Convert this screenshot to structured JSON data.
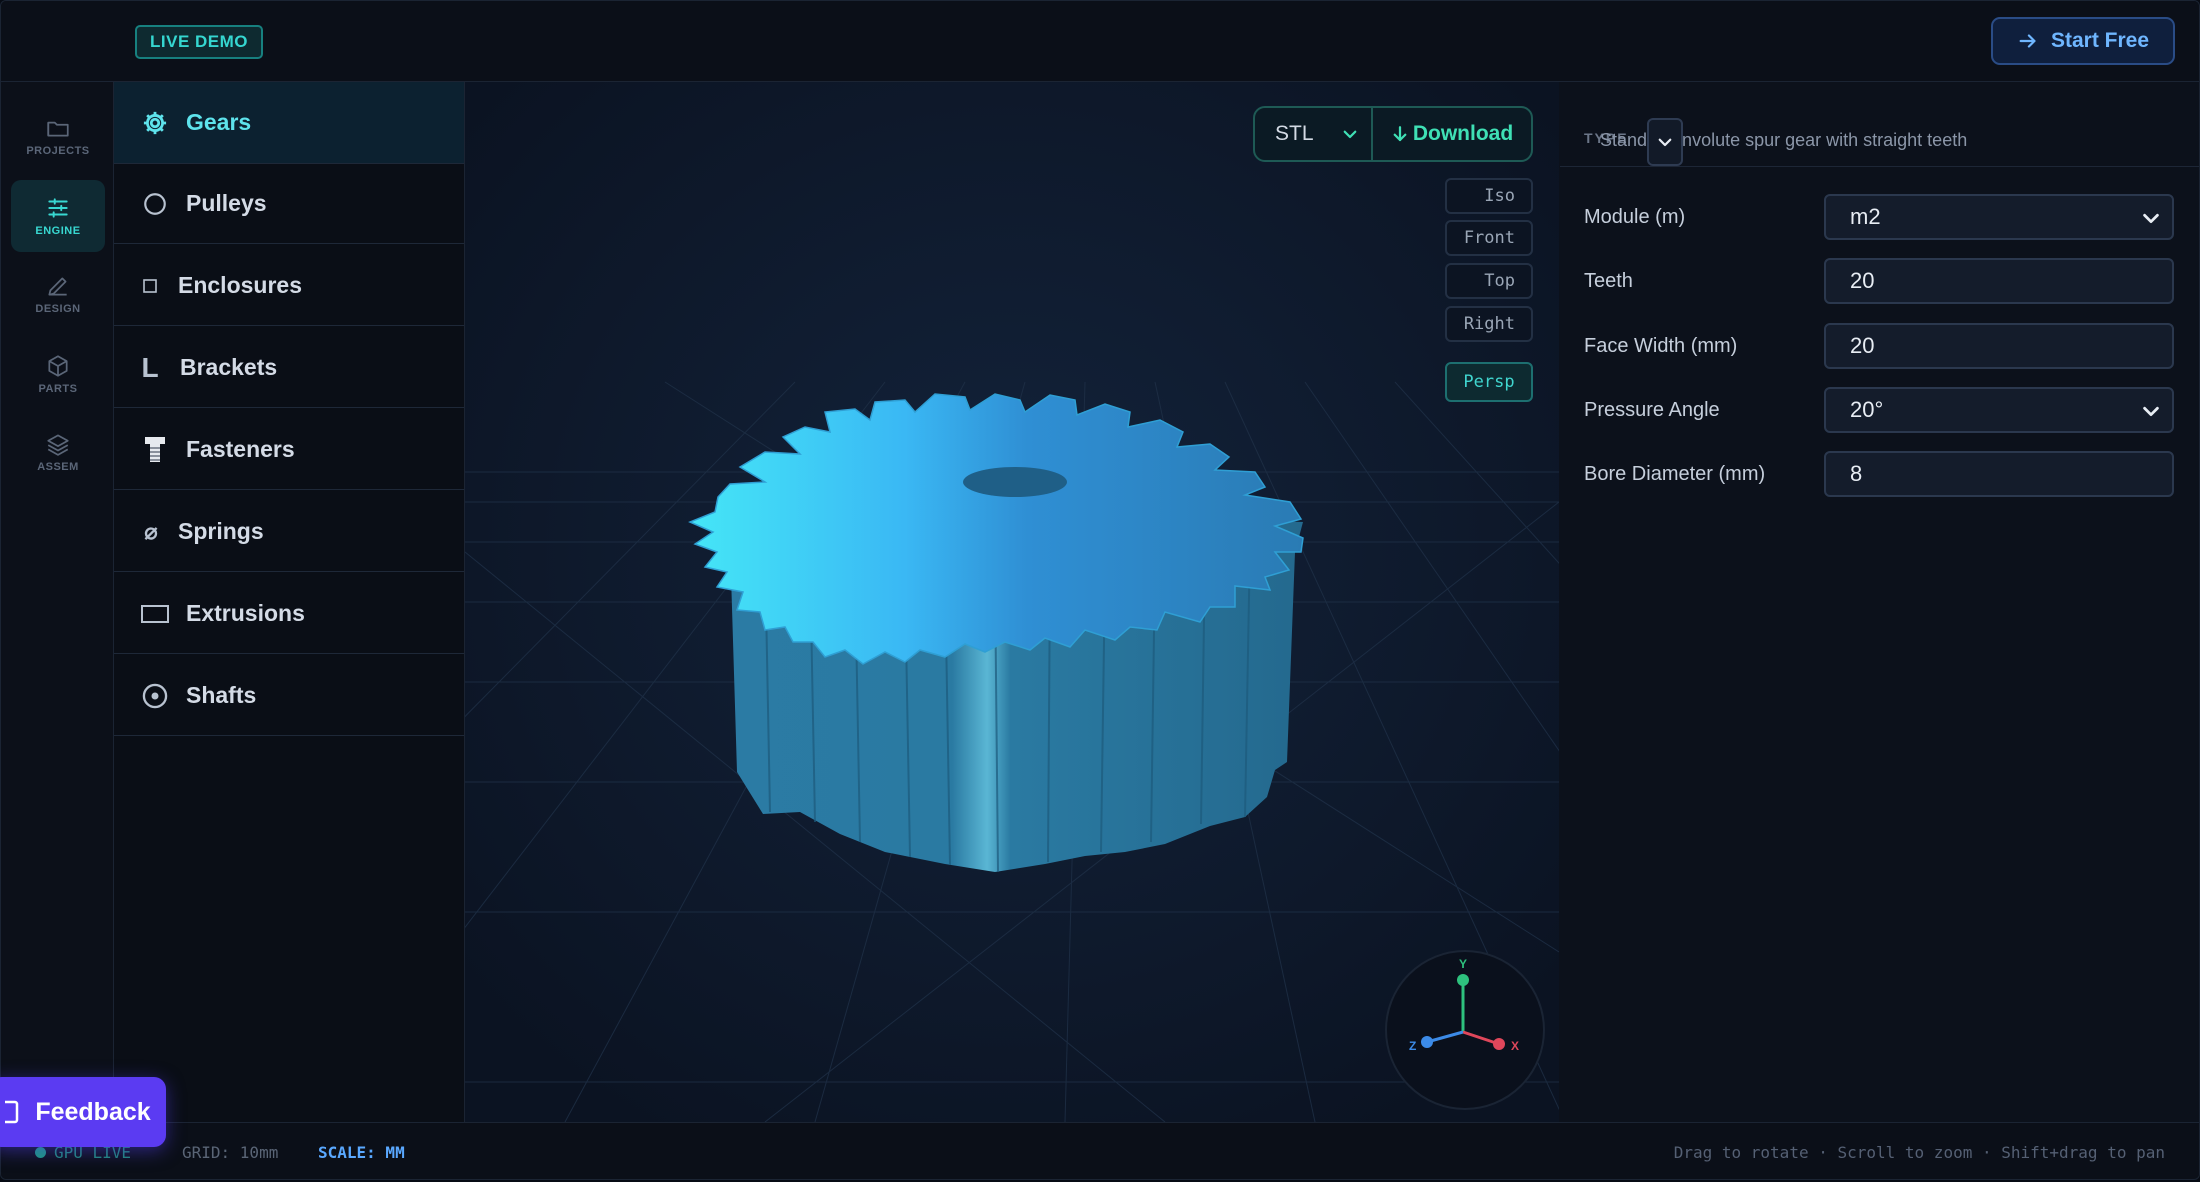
{
  "header": {
    "badge": "LIVE DEMO",
    "cta_label": "Start Free"
  },
  "rail": [
    {
      "label": "PROJECTS",
      "icon": "folder-icon"
    },
    {
      "label": "ENGINE",
      "icon": "sliders-icon",
      "active": true
    },
    {
      "label": "DESIGN",
      "icon": "pencil-icon"
    },
    {
      "label": "PARTS",
      "icon": "cube-icon"
    },
    {
      "label": "ASSEM",
      "icon": "layers-icon"
    }
  ],
  "categories": [
    {
      "label": "Gears",
      "icon": "gear-icon",
      "active": true
    },
    {
      "label": "Pulleys",
      "icon": "circle-icon"
    },
    {
      "label": "Enclosures",
      "icon": "square-icon"
    },
    {
      "label": "Brackets",
      "icon": "l-bracket-icon",
      "glyph": "L"
    },
    {
      "label": "Fasteners",
      "icon": "bolt-icon"
    },
    {
      "label": "Springs",
      "icon": "spring-icon",
      "glyph": "⌀"
    },
    {
      "label": "Extrusions",
      "icon": "rectangle-icon"
    },
    {
      "label": "Shafts",
      "icon": "target-icon"
    }
  ],
  "viewport": {
    "format": "STL",
    "download_label": "Download",
    "views": [
      "Iso",
      "Front",
      "Top",
      "Right"
    ],
    "projection": "Persp",
    "axes": {
      "x": "X",
      "y": "Y",
      "z": "Z"
    }
  },
  "panel": {
    "type_label": "TYPE",
    "type_description": "Standard involute spur gear with straight teeth",
    "params": [
      {
        "label": "Module (m)",
        "value": "m2",
        "kind": "select"
      },
      {
        "label": "Teeth",
        "value": "20",
        "kind": "input"
      },
      {
        "label": "Face Width (mm)",
        "value": "20",
        "kind": "input"
      },
      {
        "label": "Pressure Angle",
        "value": "20°",
        "kind": "select"
      },
      {
        "label": "Bore Diameter (mm)",
        "value": "8",
        "kind": "input"
      }
    ]
  },
  "footer": {
    "gpu_status": "GPU LIVE",
    "grid": "GRID: 10mm",
    "scale": "SCALE: MM",
    "hint": "Drag to rotate · Scroll to zoom · Shift+drag to pan"
  },
  "feedback_label": "Feedback",
  "colors": {
    "accent": "#38d8d1",
    "download": "#3fe0b5",
    "feedback": "#5b3bf2",
    "gear": "#2a7aa0"
  }
}
